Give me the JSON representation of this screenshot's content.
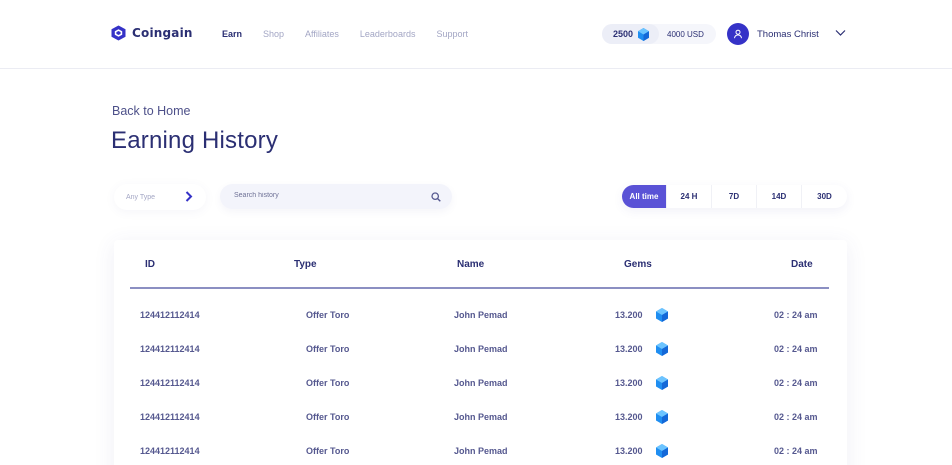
{
  "brand": {
    "name": "Coingain"
  },
  "nav": [
    {
      "label": "Earn",
      "active": true
    },
    {
      "label": "Shop",
      "active": false
    },
    {
      "label": "Affiliates",
      "active": false
    },
    {
      "label": "Leaderboards",
      "active": false
    },
    {
      "label": "Support",
      "active": false
    }
  ],
  "balance": {
    "gems": "2500",
    "usd": "4000 USD"
  },
  "user": {
    "name": "Thomas Christ"
  },
  "page": {
    "back_label": "Back to Home",
    "title": "Earning History"
  },
  "filters": {
    "type_label": "Any Type",
    "search_placeholder": "Search history",
    "time_tabs": [
      {
        "label": "All time",
        "active": true
      },
      {
        "label": "24 H",
        "active": false
      },
      {
        "label": "7D",
        "active": false
      },
      {
        "label": "14D",
        "active": false
      },
      {
        "label": "30D",
        "active": false
      }
    ]
  },
  "table": {
    "columns": [
      "ID",
      "Type",
      "Name",
      "Gems",
      "Date"
    ],
    "rows": [
      {
        "id": "124412112414",
        "type": "Offer Toro",
        "name": "John Pemad",
        "gems": "13.200",
        "date": "02 : 24 am"
      },
      {
        "id": "124412112414",
        "type": "Offer Toro",
        "name": "John Pemad",
        "gems": "13.200",
        "date": "02 : 24 am"
      },
      {
        "id": "124412112414",
        "type": "Offer Toro",
        "name": "John Pemad",
        "gems": "13.200",
        "date": "02 : 24 am"
      },
      {
        "id": "124412112414",
        "type": "Offer Toro",
        "name": "John Pemad",
        "gems": "13.200",
        "date": "02 : 24 am"
      },
      {
        "id": "124412112414",
        "type": "Offer Toro",
        "name": "John Pemad",
        "gems": "13.200",
        "date": "02 : 24 am"
      }
    ]
  },
  "colors": {
    "primary": "#2b2f73",
    "accent": "#5a52d6",
    "avatar": "#3532c7",
    "gem": "#1f8ef1",
    "muted": "#a3a6c4"
  }
}
